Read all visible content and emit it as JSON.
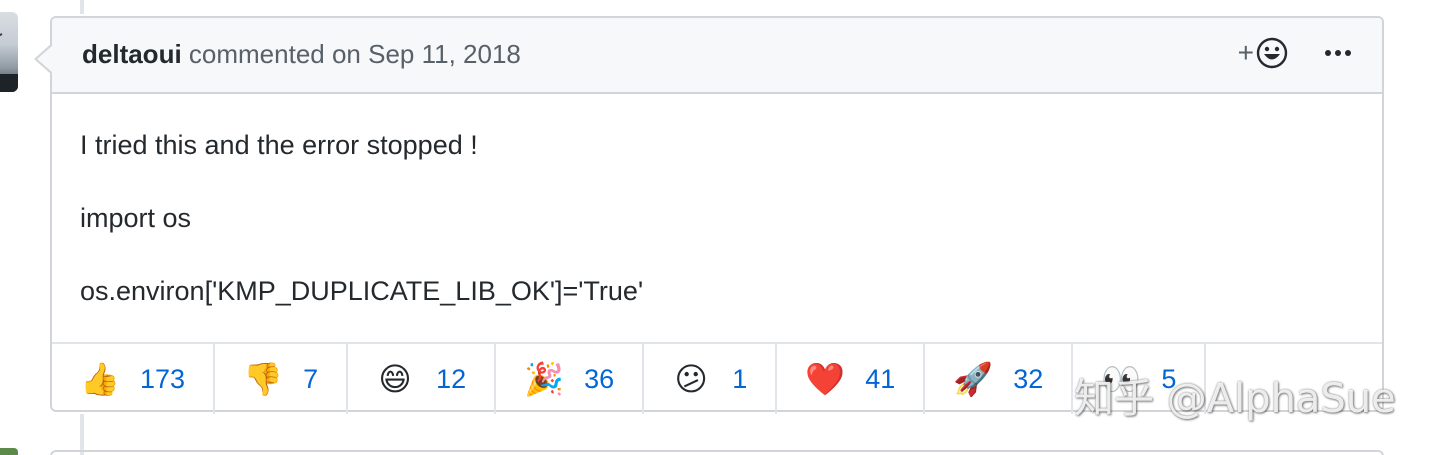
{
  "comment": {
    "author": "deltaoui",
    "meta": "commented on Sep 11, 2018",
    "add_reaction_label": "+",
    "body_lines": [
      "I tried this and the error stopped !",
      "import os",
      "os.environ['KMP_DUPLICATE_LIB_OK']='True'"
    ]
  },
  "reactions": [
    {
      "name": "thumbs-up",
      "emoji": "👍",
      "count": "173"
    },
    {
      "name": "thumbs-down",
      "emoji": "👎",
      "count": "7"
    },
    {
      "name": "laugh",
      "emoji": "😄",
      "count": "12"
    },
    {
      "name": "hooray",
      "emoji": "🎉",
      "count": "36"
    },
    {
      "name": "confused",
      "emoji": "😕",
      "count": "1"
    },
    {
      "name": "heart",
      "emoji": "❤️",
      "count": "41"
    },
    {
      "name": "rocket",
      "emoji": "🚀",
      "count": "32"
    },
    {
      "name": "eyes",
      "emoji": "👀",
      "count": "5"
    }
  ],
  "watermark": "知乎 @AlphaSue",
  "colors": {
    "link": "#0366d6",
    "border": "#d1d5da",
    "header_bg": "#f6f8fa",
    "muted_text": "#586069"
  },
  "icons": {
    "add_reaction": "smiley-icon",
    "more": "kebab-horizontal-icon"
  }
}
